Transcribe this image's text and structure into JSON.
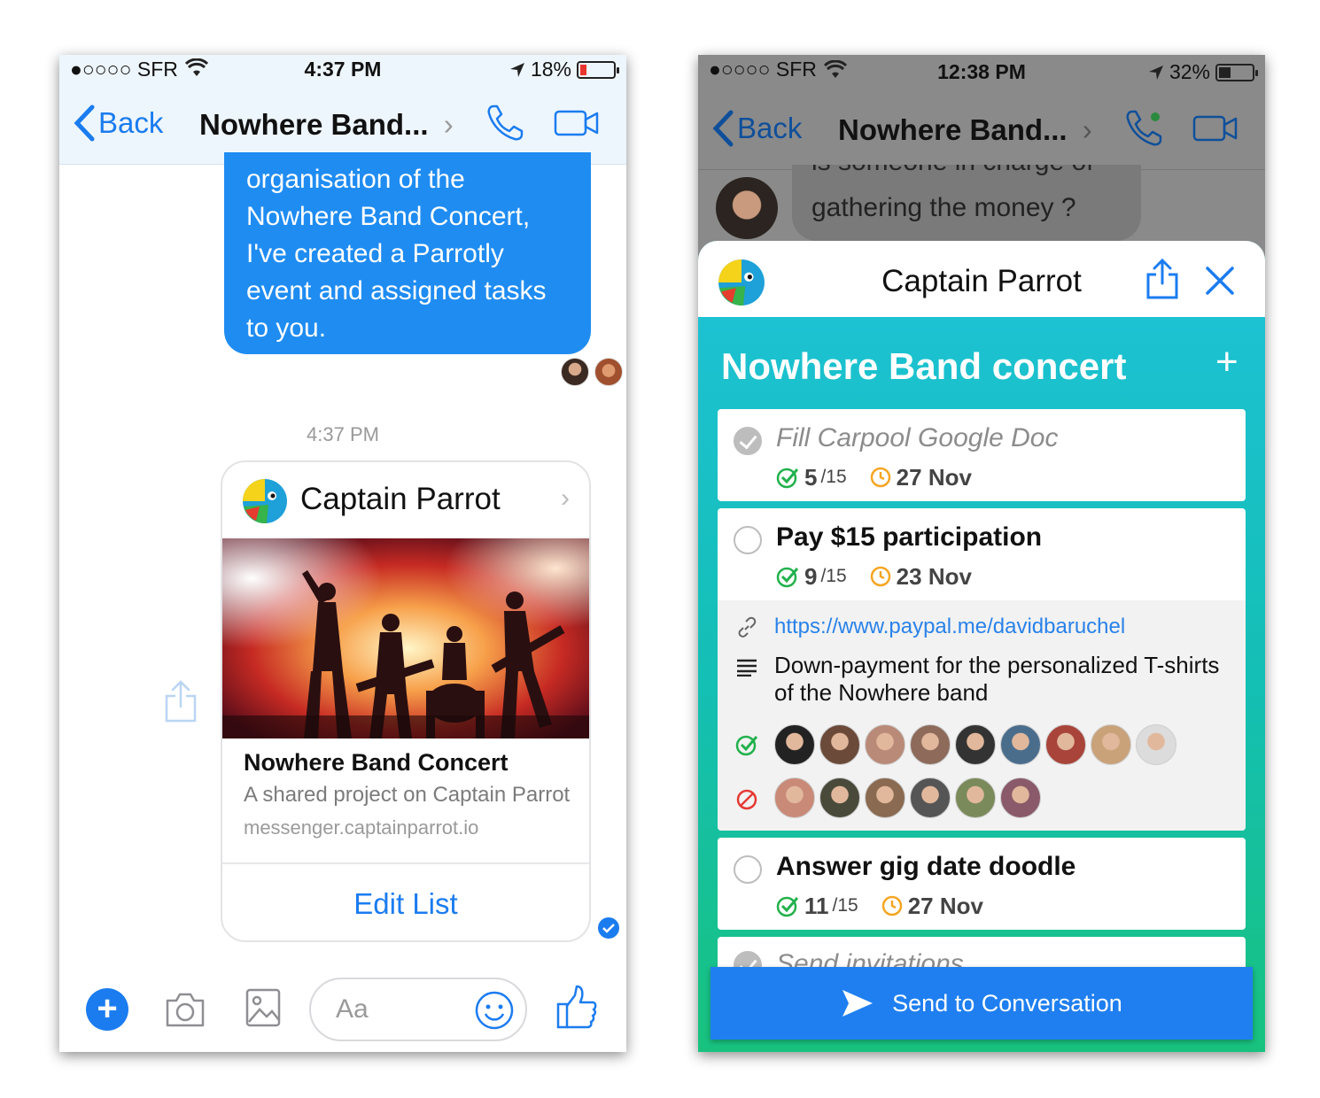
{
  "phone1": {
    "status": {
      "carrier": "●○○○○ SFR",
      "time": "4:37 PM",
      "battery": "18%"
    },
    "nav": {
      "back": "Back",
      "title": "Nowhere Band...",
      "chevron": "›"
    },
    "message_text": "organisation of the Nowhere Band Concert, I've created a Parrotly event and assigned tasks to you.",
    "timestamp": "4:37 PM",
    "card": {
      "app_name": "Captain Parrot",
      "chevron": "›",
      "title": "Nowhere Band Concert",
      "subtitle": "A shared project on Captain Parrot",
      "url": "messenger.captainparrot.io",
      "action": "Edit List"
    },
    "composer": {
      "placeholder": "Aa",
      "plus": "+"
    }
  },
  "phone2": {
    "status": {
      "carrier": "●○○○○ SFR",
      "time": "12:38 PM",
      "battery": "32%"
    },
    "nav": {
      "back": "Back",
      "title": "Nowhere Band...",
      "chevron": "›"
    },
    "message_cut": "is someone in charge of",
    "message_text": "gathering the money ?",
    "sheet": {
      "app_name": "Captain Parrot",
      "event_title": "Nowhere Band concert",
      "add": "+",
      "tasks": [
        {
          "name": "Fill Carpool Google Doc",
          "count": "5",
          "total": "/15",
          "date": "27 Nov",
          "done": true
        },
        {
          "name": "Pay $15 participation",
          "count": "9",
          "total": "/15",
          "date": "23 Nov",
          "done": false,
          "link": "https://www.paypal.me/davidbaruchel",
          "description": "Down-payment for the personalized T-shirts of the Nowhere band"
        },
        {
          "name": "Answer gig date doodle",
          "count": "11",
          "total": "/15",
          "date": "27 Nov",
          "done": false
        },
        {
          "name": "Send invitations",
          "done": true
        }
      ],
      "send_label": "Send to Conversation"
    },
    "avatar_colors_yes": [
      "#222222",
      "#6b4a3a",
      "#b98a78",
      "#8d6a5a",
      "#333333",
      "#4b6d8c",
      "#a8443a",
      "#c9a27a",
      "#dcdcdc"
    ],
    "avatar_colors_no": [
      "#c98a78",
      "#4a4a3a",
      "#8a6a50",
      "#555555",
      "#7a8a5a",
      "#8a5a6a"
    ]
  },
  "colors": {
    "messenger_blue": "#1f8cf2",
    "link_blue": "#1b7cf0",
    "check_green": "#22b14c",
    "clock_orange": "#f5a623",
    "decline_red": "#e53935",
    "teal_top": "#1ec2d8",
    "green_bottom": "#18c27e"
  }
}
